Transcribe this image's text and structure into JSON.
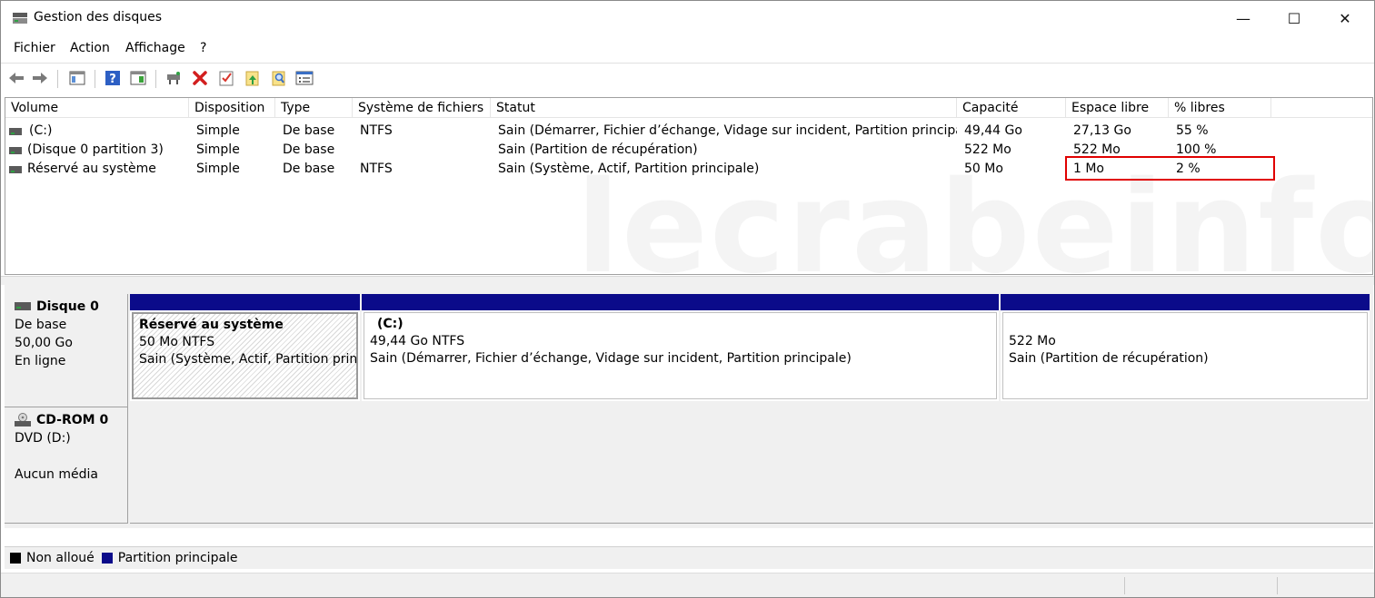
{
  "window": {
    "title": "Gestion des disques",
    "controls": {
      "minimize": "—",
      "maximize": "☐",
      "close": "✕"
    }
  },
  "menu": [
    "Fichier",
    "Action",
    "Affichage",
    "?"
  ],
  "toolbar": {
    "icons": [
      "back-arrow-icon",
      "forward-arrow-icon",
      "console-tree-icon",
      "help-icon",
      "properties-icon",
      "connect-drive-icon",
      "delete-icon",
      "check-icon",
      "folder-up-icon",
      "folder-search-icon",
      "properties-list-icon"
    ]
  },
  "volume_list": {
    "columns": [
      "Volume",
      "Disposition",
      "Type",
      "Système de fichiers",
      "Statut",
      "Capacité",
      "Espace libre",
      "% libres"
    ],
    "rows": [
      {
        "volume": " (C:)",
        "disposition": "Simple",
        "type": "De base",
        "fs": "NTFS",
        "status": "Sain (Démarrer, Fichier d’échange, Vidage sur incident, Partition principale)",
        "capacity": "49,44 Go",
        "free": "27,13 Go",
        "pct": "55 %"
      },
      {
        "volume": "(Disque 0 partition 3)",
        "disposition": "Simple",
        "type": "De base",
        "fs": "",
        "status": "Sain (Partition de récupération)",
        "capacity": "522 Mo",
        "free": "522 Mo",
        "pct": "100 %"
      },
      {
        "volume": "Réservé au système",
        "disposition": "Simple",
        "type": "De base",
        "fs": "NTFS",
        "status": "Sain (Système, Actif, Partition principale)",
        "capacity": "50 Mo",
        "free": "1 Mo",
        "pct": "2 %"
      }
    ],
    "highlight_color": "#e00000"
  },
  "watermark": "lecrabeinfo",
  "disks": [
    {
      "name": "Disque 0",
      "lines": [
        "De base",
        "50,00 Go",
        "En ligne"
      ],
      "partitions": [
        {
          "title": "Réservé au système",
          "size": "50 Mo NTFS",
          "status": "Sain (Système, Actif, Partition princi"
        },
        {
          "title": "(C:)",
          "size": "49,44 Go NTFS",
          "status": "Sain (Démarrer, Fichier d’échange, Vidage sur incident, Partition principale)"
        },
        {
          "title": "",
          "size": "522 Mo",
          "status": "Sain (Partition de récupération)"
        }
      ]
    },
    {
      "name": "CD-ROM 0",
      "lines": [
        "DVD (D:)",
        "",
        "Aucun média"
      ]
    }
  ],
  "legend": [
    {
      "label": "Non alloué",
      "color": "#000000"
    },
    {
      "label": "Partition principale",
      "color": "#0b0b8a"
    }
  ]
}
